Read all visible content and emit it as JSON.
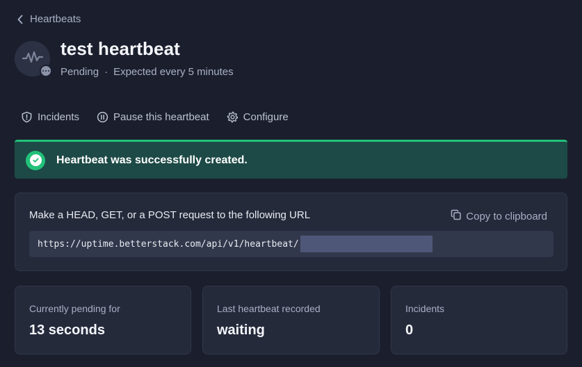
{
  "breadcrumb": {
    "label": "Heartbeats",
    "icon": "chevron-left-icon"
  },
  "monitor": {
    "title": "test heartbeat",
    "status": "Pending",
    "separator": "·",
    "schedule": "Expected every 5 minutes",
    "avatar_icon": "pulse-icon",
    "status_icon": "ellipsis-icon"
  },
  "actions": [
    {
      "label": "Incidents",
      "icon": "shield-exclamation-icon"
    },
    {
      "label": "Pause this heartbeat",
      "icon": "pause-circle-icon"
    },
    {
      "label": "Configure",
      "icon": "gear-icon"
    }
  ],
  "banner": {
    "message": "Heartbeat was successfully created.",
    "icon": "check-circle-icon",
    "color": "#22c17a"
  },
  "url_card": {
    "instructions": "Make a HEAD, GET, or a POST request to the following URL",
    "copy_label": "Copy to clipboard",
    "copy_icon": "copy-icon",
    "url_prefix": "https://uptime.betterstack.com/api/v1/heartbeat/"
  },
  "stats": [
    {
      "label": "Currently pending for",
      "value": "13 seconds"
    },
    {
      "label": "Last heartbeat recorded",
      "value": "waiting"
    },
    {
      "label": "Incidents",
      "value": "0"
    }
  ]
}
